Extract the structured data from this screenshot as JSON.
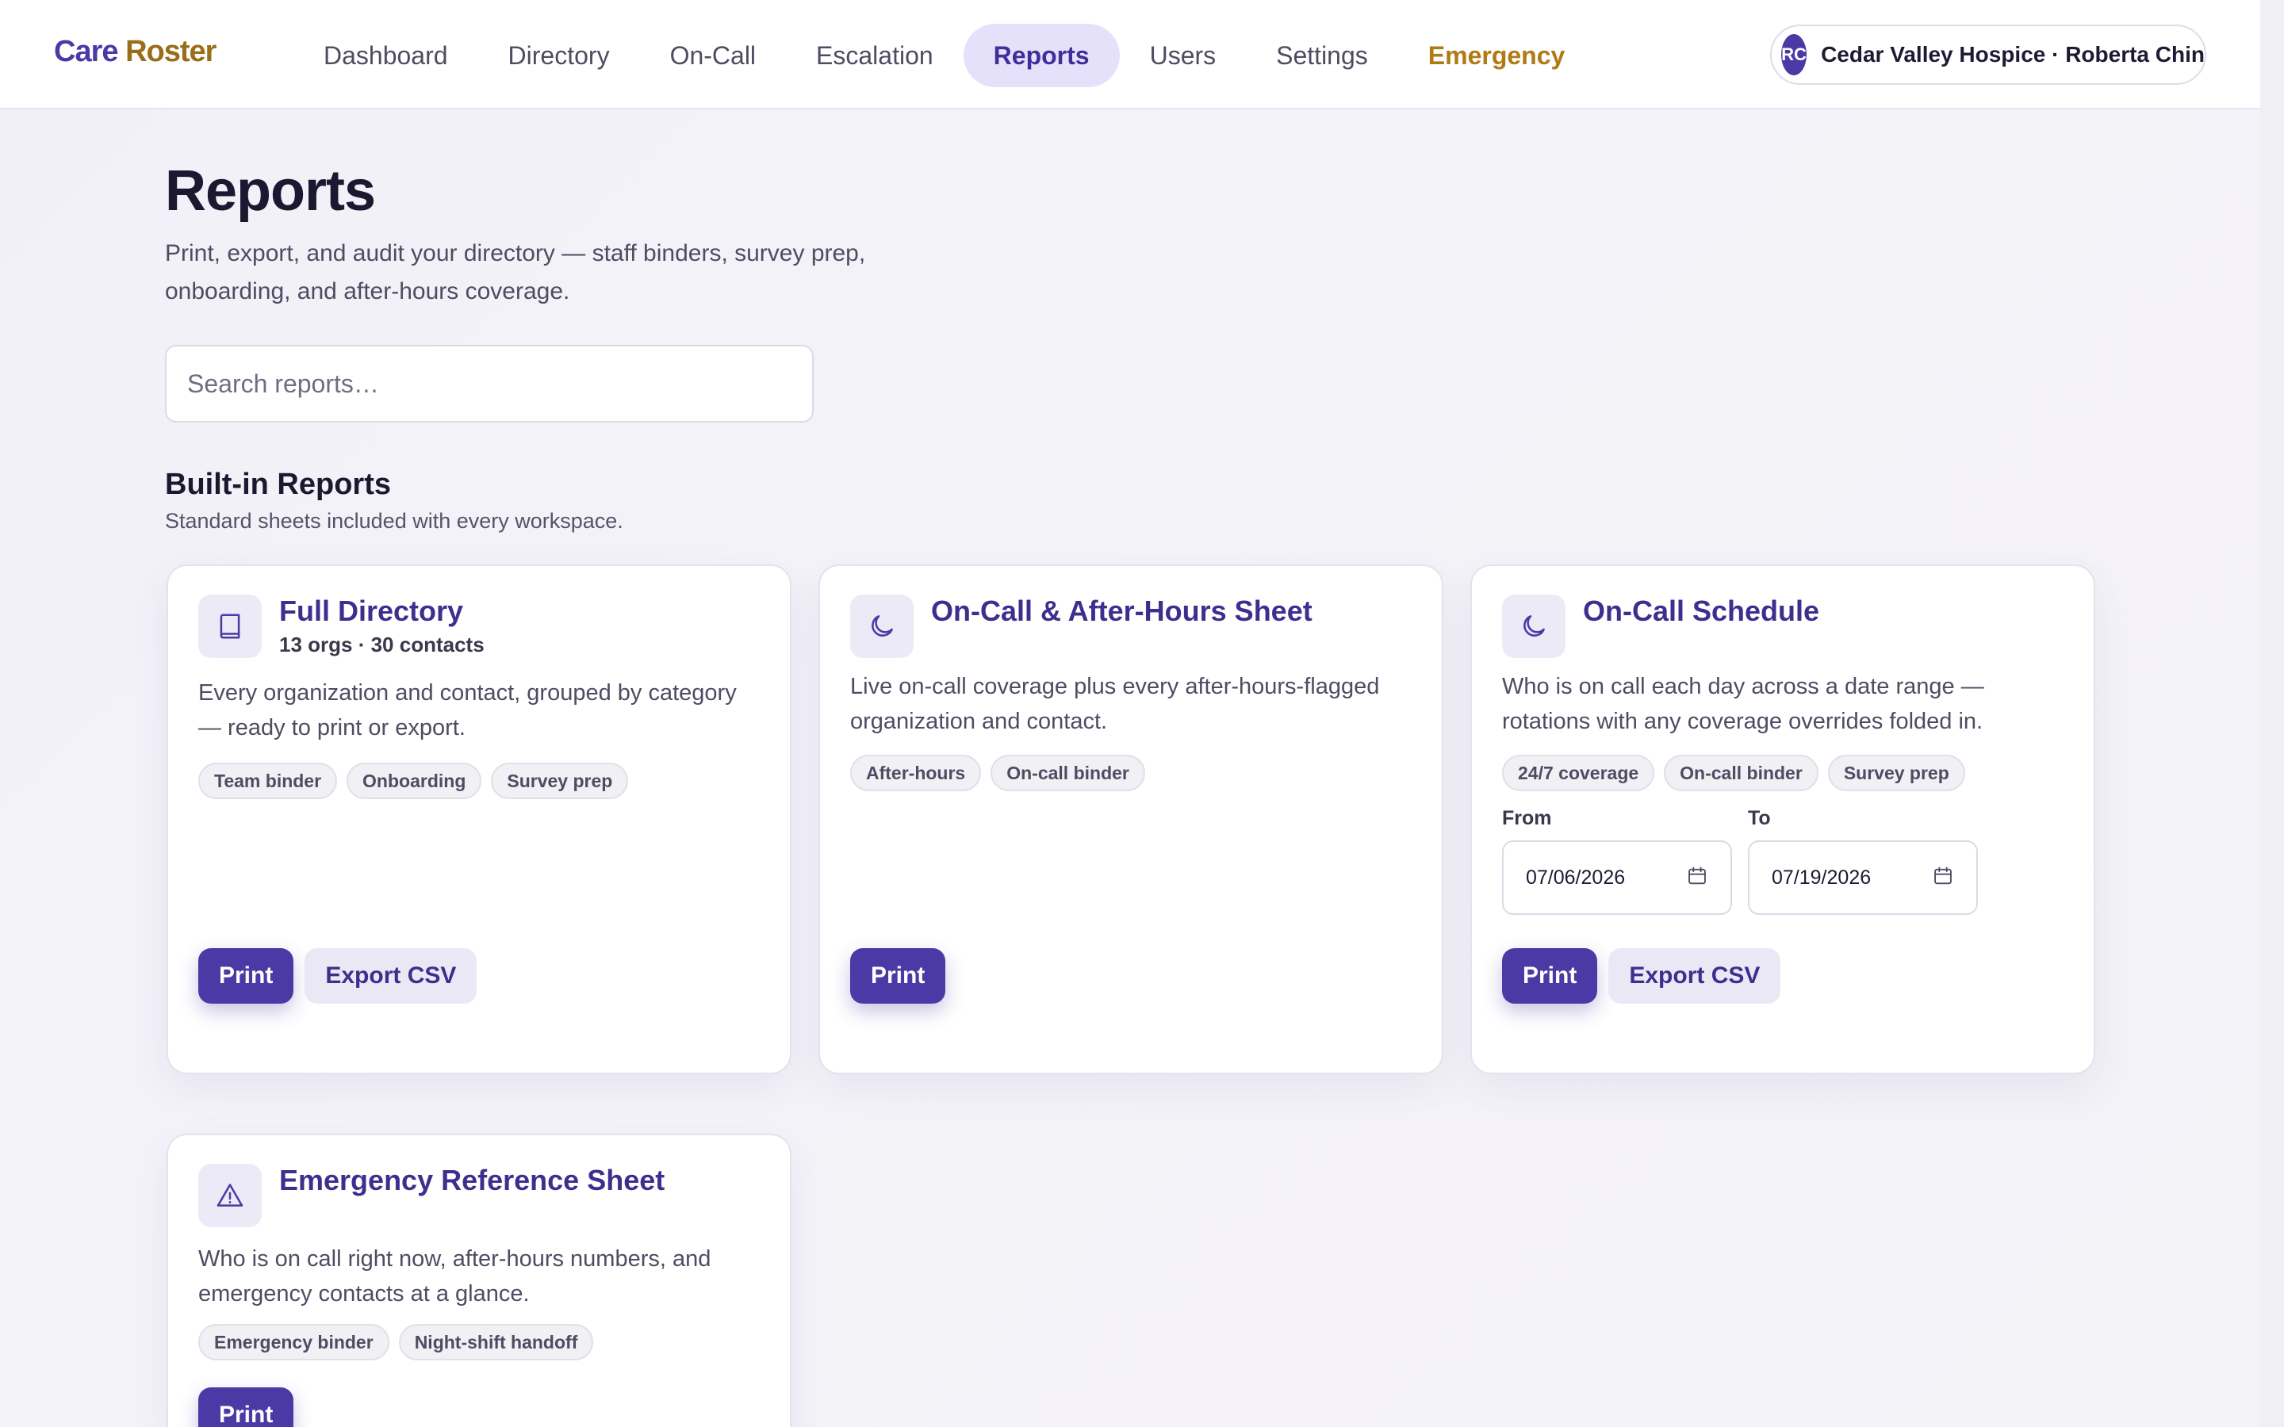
{
  "brand": {
    "part1": "Care",
    "part2": "Roster"
  },
  "nav": {
    "items": [
      {
        "label": "Dashboard"
      },
      {
        "label": "Directory"
      },
      {
        "label": "On-Call"
      },
      {
        "label": "Escalation"
      },
      {
        "label": "Reports",
        "active": true
      },
      {
        "label": "Users"
      },
      {
        "label": "Settings"
      },
      {
        "label": "Emergency"
      }
    ]
  },
  "account": {
    "initials": "RC",
    "label": "Cedar Valley Hospice · Roberta Chin"
  },
  "page": {
    "title": "Reports",
    "subtitle": "Print, export, and audit your directory — staff binders, survey prep, onboarding, and after-hours coverage."
  },
  "search": {
    "placeholder": "Search reports…",
    "value": ""
  },
  "section": {
    "title": "Built-in Reports",
    "subtitle": "Standard sheets included with every workspace."
  },
  "cards": {
    "full_directory": {
      "icon": "book-icon",
      "title": "Full Directory",
      "meta": "13 orgs · 30 contacts",
      "description": "Every organization and contact, grouped by category — ready to print or export.",
      "tags": [
        "Team binder",
        "Onboarding",
        "Survey prep"
      ],
      "print_label": "Print",
      "export_label": "Export CSV"
    },
    "after_hours": {
      "icon": "moon-icon",
      "title": "On-Call & After-Hours Sheet",
      "description": "Live on-call coverage plus every after-hours-flagged organization and contact.",
      "tags": [
        "After-hours",
        "On-call binder"
      ],
      "print_label": "Print"
    },
    "schedule": {
      "icon": "moon-icon",
      "title": "On-Call Schedule",
      "description": "Who is on call each day across a date range — rotations with any coverage overrides folded in.",
      "tags": [
        "24/7 coverage",
        "On-call binder",
        "Survey prep"
      ],
      "from_label": "From",
      "from_value": "07/06/2026",
      "to_label": "To",
      "to_value": "07/19/2026",
      "print_label": "Print",
      "export_label": "Export CSV"
    },
    "emergency": {
      "icon": "warning-icon",
      "title": "Emergency Reference Sheet",
      "description": "Who is on call right now, after-hours numbers, and emergency contacts at a glance.",
      "tags": [
        "Emergency binder",
        "Night-shift handoff"
      ],
      "print_label": "Print"
    }
  },
  "colors": {
    "accent": "#4b3aa5",
    "brand_gold": "#9a6d18",
    "emergency": "#b07a14",
    "active_nav_bg": "#e6e1fa"
  }
}
